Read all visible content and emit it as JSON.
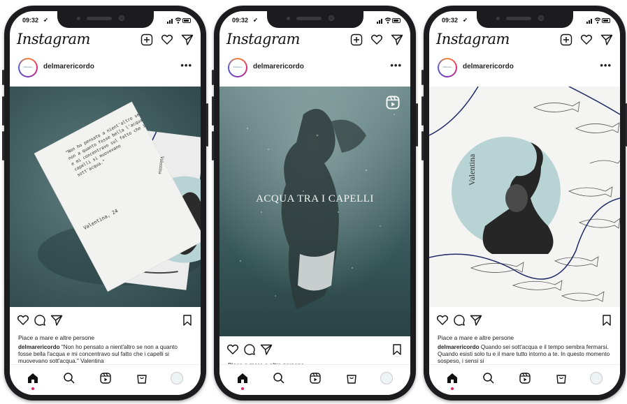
{
  "status": {
    "time": "09:32"
  },
  "app": {
    "logo": "Instagram"
  },
  "post": {
    "username": "delmarericordo",
    "avatar_text": "Mélusine",
    "more": "•••"
  },
  "phones": [
    {
      "likes": "Piace a mare e altre persone",
      "caption_user": "delmarericordo",
      "caption_text": " \"Non ho pensato a nient'altro se non a quanto fosse bella l'acqua e mi concentravo sul fatto che i capelli si muovevano sott'acqua.\" Valentina",
      "card_text": "\"Non ho pensato a nient'altro se non a quanto fosse bella l'acqua e mi concentravo sul fatto che i capelli si muovevano sott'acqua.\"",
      "card_sign": "Valentina, 24",
      "card_side": "Valentina"
    },
    {
      "likes": "Piace a mare e altre persone",
      "overlay_title": "ACQUA TRA I CAPELLI"
    },
    {
      "likes": "Piace a mare e altre persone",
      "caption_user": "delmarericordo",
      "caption_text": " Quando sei sott'acqua e il tempo sembra fermarsi. Quando esisti solo tu e il mare tutto intorno a te. In questo momento sospeso, i sensi si",
      "side_name": "Valentina"
    }
  ],
  "icons": {
    "header": [
      "new-post-icon",
      "heart-icon",
      "direct-message-icon"
    ],
    "actions": [
      "like-icon",
      "comment-icon",
      "share-icon",
      "save-icon"
    ],
    "nav": [
      "home-icon",
      "search-icon",
      "reels-icon",
      "shop-icon",
      "profile-avatar"
    ]
  },
  "colors": {
    "accent_red": "#e0245e",
    "teal_bg": "#3f5c5f",
    "circle": "#b7d3d4",
    "navy_line": "#1e2a66"
  }
}
